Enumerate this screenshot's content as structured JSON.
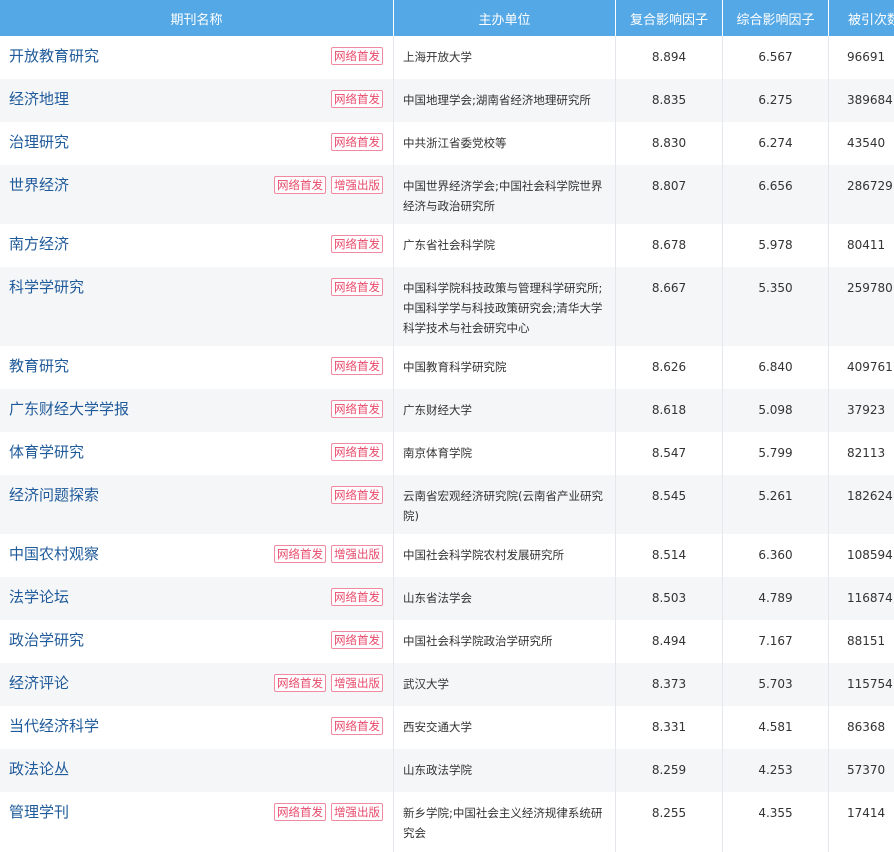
{
  "headers": {
    "name": "期刊名称",
    "unit": "主办单位",
    "composite": "复合影响因子",
    "comprehensive": "综合影响因子",
    "citations": "被引次数"
  },
  "badge_labels": {
    "network": "网络首发",
    "enhanced": "增强出版"
  },
  "rows": [
    {
      "name": "开放教育研究",
      "badges": [
        "网络首发"
      ],
      "unit": "上海开放大学",
      "composite": "8.894",
      "comprehensive": "6.567",
      "citations": "96691"
    },
    {
      "name": "经济地理",
      "badges": [
        "网络首发"
      ],
      "unit": "中国地理学会;湖南省经济地理研究所",
      "composite": "8.835",
      "comprehensive": "6.275",
      "citations": "389684"
    },
    {
      "name": "治理研究",
      "badges": [
        "网络首发"
      ],
      "unit": "中共浙江省委党校等",
      "composite": "8.830",
      "comprehensive": "6.274",
      "citations": "43540"
    },
    {
      "name": "世界经济",
      "badges": [
        "网络首发",
        "增强出版"
      ],
      "unit": "中国世界经济学会;中国社会科学院世界经济与政治研究所",
      "composite": "8.807",
      "comprehensive": "6.656",
      "citations": "286729"
    },
    {
      "name": "南方经济",
      "badges": [
        "网络首发"
      ],
      "unit": "广东省社会科学院",
      "composite": "8.678",
      "comprehensive": "5.978",
      "citations": "80411"
    },
    {
      "name": "科学学研究",
      "badges": [
        "网络首发"
      ],
      "unit": "中国科学院科技政策与管理科学研究所;中国科学学与科技政策研究会;清华大学科学技术与社会研究中心",
      "composite": "8.667",
      "comprehensive": "5.350",
      "citations": "259780"
    },
    {
      "name": "教育研究",
      "badges": [
        "网络首发"
      ],
      "unit": "中国教育科学研究院",
      "composite": "8.626",
      "comprehensive": "6.840",
      "citations": "409761"
    },
    {
      "name": "广东财经大学学报",
      "badges": [
        "网络首发"
      ],
      "unit": "广东财经大学",
      "composite": "8.618",
      "comprehensive": "5.098",
      "citations": "37923"
    },
    {
      "name": "体育学研究",
      "badges": [
        "网络首发"
      ],
      "unit": "南京体育学院",
      "composite": "8.547",
      "comprehensive": "5.799",
      "citations": "82113"
    },
    {
      "name": "经济问题探索",
      "badges": [
        "网络首发"
      ],
      "unit": "云南省宏观经济研究院(云南省产业研究院)",
      "composite": "8.545",
      "comprehensive": "5.261",
      "citations": "182624"
    },
    {
      "name": "中国农村观察",
      "badges": [
        "网络首发",
        "增强出版"
      ],
      "unit": "中国社会科学院农村发展研究所",
      "composite": "8.514",
      "comprehensive": "6.360",
      "citations": "108594"
    },
    {
      "name": "法学论坛",
      "badges": [
        "网络首发"
      ],
      "unit": "山东省法学会",
      "composite": "8.503",
      "comprehensive": "4.789",
      "citations": "116874"
    },
    {
      "name": "政治学研究",
      "badges": [
        "网络首发"
      ],
      "unit": "中国社会科学院政治学研究所",
      "composite": "8.494",
      "comprehensive": "7.167",
      "citations": "88151"
    },
    {
      "name": "经济评论",
      "badges": [
        "网络首发",
        "增强出版"
      ],
      "unit": "武汉大学",
      "composite": "8.373",
      "comprehensive": "5.703",
      "citations": "115754"
    },
    {
      "name": "当代经济科学",
      "badges": [
        "网络首发"
      ],
      "unit": "西安交通大学",
      "composite": "8.331",
      "comprehensive": "4.581",
      "citations": "86368"
    },
    {
      "name": "政法论丛",
      "badges": [],
      "unit": "山东政法学院",
      "composite": "8.259",
      "comprehensive": "4.253",
      "citations": "57370"
    },
    {
      "name": "管理学刊",
      "badges": [
        "网络首发",
        "增强出版"
      ],
      "unit": "新乡学院;中国社会主义经济规律系统研究会",
      "composite": "8.255",
      "comprehensive": "4.355",
      "citations": "17414"
    }
  ],
  "colors": {
    "header_bg": "#55a8e6",
    "link": "#1f5a9a",
    "badge": "#e84a6b",
    "alt_row": "#f5f6f8"
  }
}
